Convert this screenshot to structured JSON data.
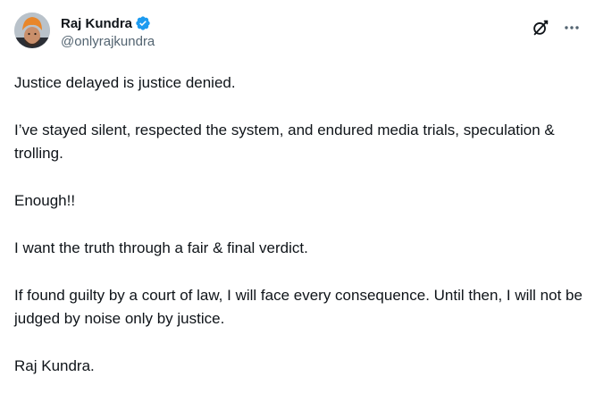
{
  "author": {
    "display_name": "Raj Kundra",
    "handle": "@onlyrajkundra",
    "verified": true,
    "avatar_icon": "profile-avatar-turban"
  },
  "actions": {
    "grok_icon": "grok-icon",
    "more_icon": "more-horizontal-icon"
  },
  "post": {
    "paragraphs": [
      "Justice delayed is justice denied.",
      "I’ve stayed silent, respected the system, and endured media trials, speculation & trolling.",
      "Enough!!",
      "I want the truth through a fair & final verdict.",
      "If found guilty by a court of law, I will face every consequence. Until then, I will not be judged by noise only by justice.",
      "Raj Kundra."
    ]
  },
  "colors": {
    "text": "#0f1419",
    "secondary": "#536471",
    "verified": "#1d9bf0",
    "turban": "#e8862a"
  }
}
